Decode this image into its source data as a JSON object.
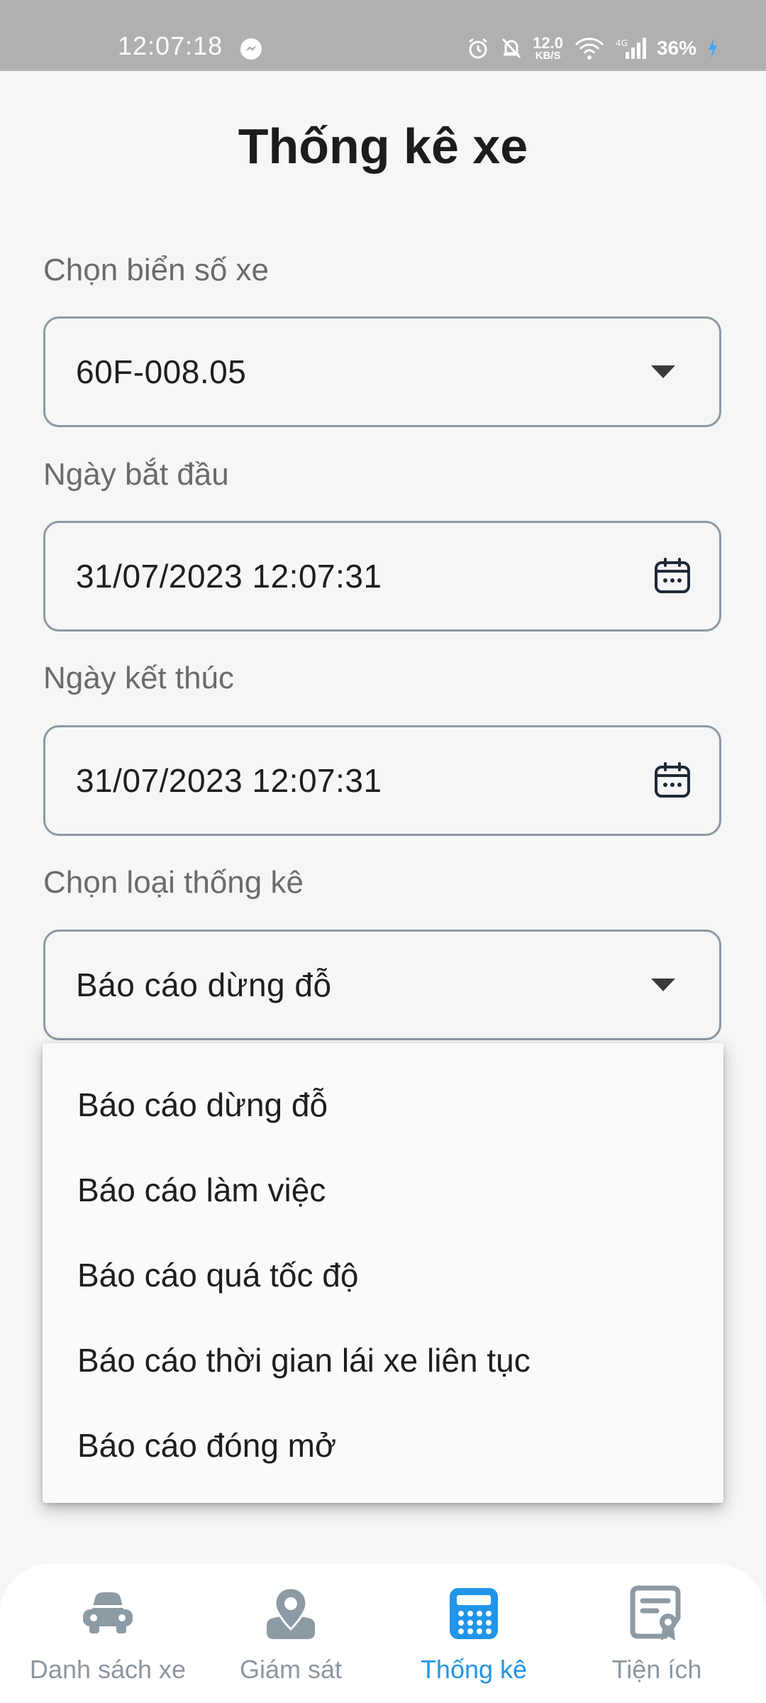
{
  "status_bar": {
    "time": "12:07:18",
    "net_speed_value": "12.0",
    "net_speed_unit": "KB/S",
    "battery": "36%"
  },
  "page": {
    "title": "Thống kê xe"
  },
  "form": {
    "plate": {
      "label": "Chọn biển số xe",
      "value": "60F-008.05"
    },
    "start_date": {
      "label": "Ngày bắt đầu",
      "value": "31/07/2023 12:07:31"
    },
    "end_date": {
      "label": "Ngày kết thúc",
      "value": "31/07/2023 12:07:31"
    },
    "report_type": {
      "label": "Chọn loại thống kê",
      "value": "Báo cáo dừng đỗ"
    }
  },
  "dropdown": {
    "options": [
      "Báo cáo dừng đỗ",
      "Báo cáo làm việc",
      "Báo cáo quá tốc độ",
      "Báo cáo thời gian lái xe liên tục",
      "Báo cáo đóng mở"
    ]
  },
  "bottom_nav": {
    "items": [
      {
        "label": "Danh sách xe",
        "icon": "car-icon"
      },
      {
        "label": "Giám sát",
        "icon": "map-pin-icon"
      },
      {
        "label": "Thống kê",
        "icon": "calculator-icon",
        "active": true
      },
      {
        "label": "Tiện ích",
        "icon": "certificate-icon"
      }
    ]
  },
  "colors": {
    "accent": "#2196e8",
    "nav_inactive": "#8c96a0",
    "border": "#8d98a4",
    "status_bar": "#b0b0b0"
  }
}
